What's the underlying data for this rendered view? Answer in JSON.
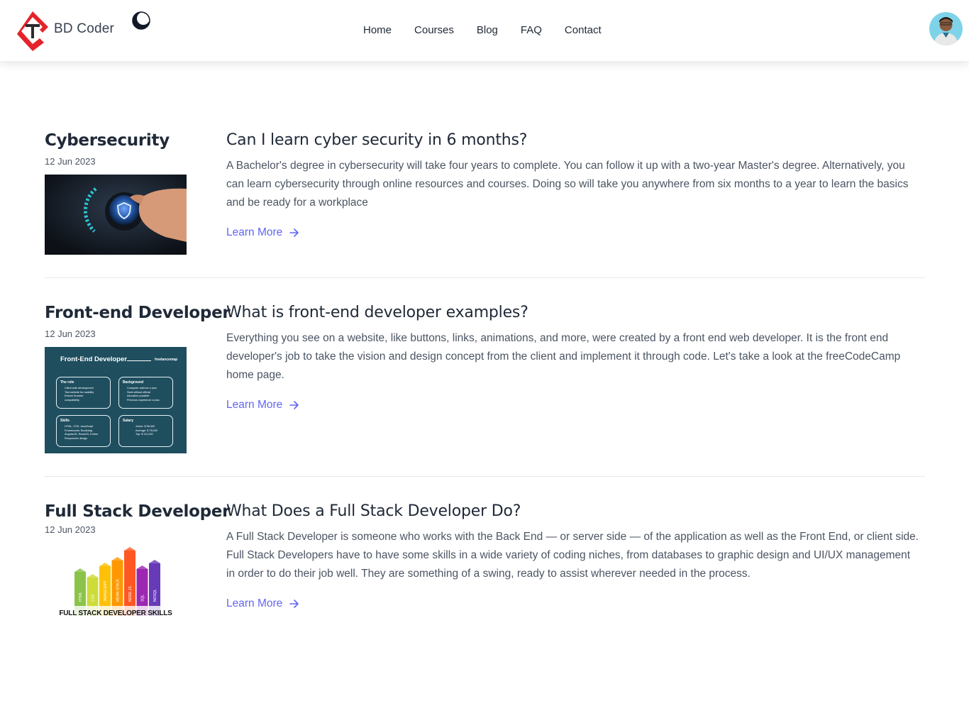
{
  "header": {
    "brand": "BD Coder",
    "logo_icon": "bd-coder-logo",
    "theme_toggle_icon": "moon-icon",
    "nav": [
      "Home",
      "Courses",
      "Blog",
      "FAQ",
      "Contact"
    ],
    "avatar_icon": "user-avatar"
  },
  "colors": {
    "accent": "#6366f1",
    "logo_red": "#e5232b",
    "logo_dark": "#2b2b2b",
    "text_dark": "#1f2937",
    "text_muted": "#4b5563",
    "divider": "#e5e7eb"
  },
  "posts": [
    {
      "category": "Cybersecurity",
      "date": "12 Jun 2023",
      "title": "Can I learn cyber security in 6 months?",
      "excerpt": "A Bachelor's degree in cybersecurity will take four years to complete. You can follow it up with a two-year Master's degree. Alternatively, you can learn cybersecurity through online resources and courses. Doing so will take you anywhere from six months to a year to learn the basics and be ready for a workplace",
      "link": "Learn More",
      "thumb_icon": "cybersecurity-image"
    },
    {
      "category": "Front-end Developer",
      "date": "12 Jun 2023",
      "title": "What is front-end developer examples?",
      "excerpt": "Everything you see on a website, like buttons, links, animations, and more, were created by a front end web developer. It is the front end developer's job to take the vision and design concept from the client and implement it through code. Let's take a look at the freeCodeCamp home page.",
      "link": "Learn More",
      "thumb_icon": "frontend-roadmap-image",
      "thumb": {
        "heading": "Front-End Developer",
        "brand": "freelancemap",
        "boxes": [
          {
            "title": "The role",
            "lines": [
              "Client-side development",
              "Test website for usability",
              "Ensure browser",
              "compatibility"
            ]
          },
          {
            "title": "Background",
            "lines": [
              "Computer science a plus",
              "Start without official",
              "education possible",
              "Previous experience a plus"
            ]
          },
          {
            "title": "Skills",
            "lines": [
              "HTML, CSS, JavaScript",
              "Frameworks: Bootstrap,",
              "AngularJS, ReactJS, Ember",
              "Responsive design"
            ]
          },
          {
            "title": "Salary",
            "lines": [
              "Junior: $ 56,000",
              "Average: $ 78,000",
              "Top: $ 111,000"
            ]
          }
        ]
      }
    },
    {
      "category": "Full Stack Developer",
      "date": "12 Jun 2023",
      "title": "What Does a Full Stack Developer Do?",
      "excerpt": "A Full Stack Developer is someone who works with the Back End — or server side — of the application as well as the Front End, or client side. Full Stack Developers have to have some skills in a wide variety of coding niches, from databases to graphic design and UI/UX management in order to do their job well. They are something of a swing, ready to assist wherever needed in the process.",
      "link": "Learn More",
      "thumb_icon": "fullstack-skills-image",
      "thumb": {
        "caption": "FULL STACK DEVELOPER SKILLS",
        "bars": [
          {
            "label": "HTML",
            "color": "#8bc34a"
          },
          {
            "label": "CSS",
            "color": "#cddc39"
          },
          {
            "label": "JAVASCRIPT",
            "color": "#ffc107"
          },
          {
            "label": "MEAN STACK",
            "color": "#ff9800"
          },
          {
            "label": "NODE.JS",
            "color": "#ff5722"
          },
          {
            "label": "SQL",
            "color": "#9c27b0"
          },
          {
            "label": "NOSQL",
            "color": "#673ab7"
          }
        ]
      }
    }
  ]
}
